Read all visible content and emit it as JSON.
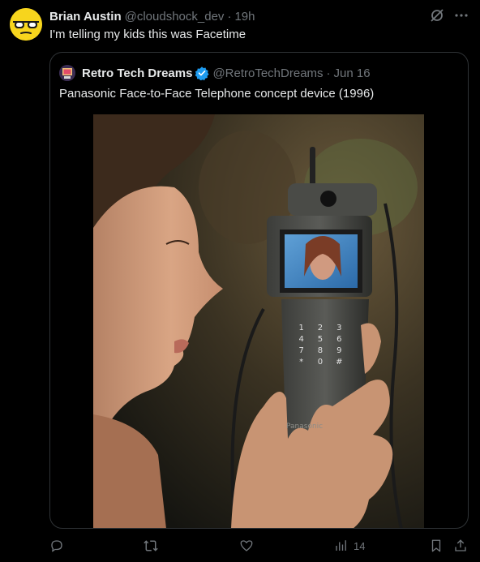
{
  "post": {
    "display_name": "Brian Austin",
    "handle": "@cloudshock_dev",
    "separator": "·",
    "time": "19h",
    "text": "I'm telling my kids this was Facetime"
  },
  "quote": {
    "display_name": "Retro Tech Dreams",
    "handle": "@RetroTechDreams",
    "separator": "·",
    "date": "Jun 16",
    "text": "Panasonic Face-to-Face Telephone concept device (1996)",
    "verified": true,
    "image_alt": "Woman holding a Panasonic video phone with a small screen showing another woman",
    "phone_keypad": [
      "1",
      "2",
      "3",
      "4",
      "5",
      "6",
      "7",
      "8",
      "9",
      "*",
      "0",
      "#"
    ],
    "phone_brand": "Panasonic"
  },
  "actions": {
    "views_count": "14"
  },
  "icons": {
    "avatar": "sunglasses-emoji-avatar",
    "grok": "grok-icon",
    "more": "more-dots-icon",
    "reply": "reply-icon",
    "repost": "repost-icon",
    "like": "like-icon",
    "views": "views-icon",
    "bookmark": "bookmark-icon",
    "share": "share-icon"
  },
  "colors": {
    "background": "#000000",
    "text": "#e7e9ea",
    "secondary": "#71767b",
    "border": "#2f3336",
    "verified": "#1d9bf0",
    "avatar": "#f7d51d"
  }
}
